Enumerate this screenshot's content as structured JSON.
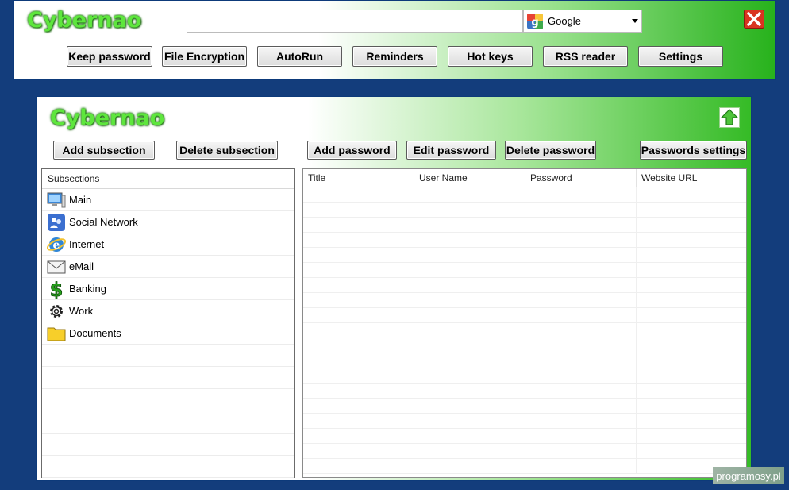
{
  "top": {
    "logo": "Cybernao",
    "search": {
      "value": "",
      "placeholder": ""
    },
    "engine": "Google",
    "buttons": [
      "Keep password",
      "File Encryption",
      "AutoRun",
      "Reminders",
      "Hot keys",
      "RSS reader",
      "Settings"
    ]
  },
  "panel": {
    "logo": "Cybernao",
    "subsection_buttons": {
      "add": "Add subsection",
      "delete": "Delete subsection"
    },
    "password_buttons": {
      "add": "Add password",
      "edit": "Edit password",
      "delete": "Delete password",
      "settings": "Passwords settings"
    },
    "subsections": {
      "header": "Subsections",
      "items": [
        {
          "label": "Main",
          "icon": "computer-icon"
        },
        {
          "label": "Social Network",
          "icon": "social-network-icon"
        },
        {
          "label": "Internet",
          "icon": "internet-explorer-icon"
        },
        {
          "label": "eMail",
          "icon": "envelope-icon"
        },
        {
          "label": "Banking",
          "icon": "dollar-icon"
        },
        {
          "label": "Work",
          "icon": "gear-icon"
        },
        {
          "label": "Documents",
          "icon": "folder-icon"
        }
      ]
    },
    "passwords": {
      "columns": [
        "Title",
        "User Name",
        "Password",
        "Website URL"
      ],
      "rows": []
    }
  },
  "watermark": "programosy.pl",
  "colors": {
    "background": "#133d7c",
    "accent_green": "#27b21c",
    "logo_green": "#5ee63d"
  }
}
